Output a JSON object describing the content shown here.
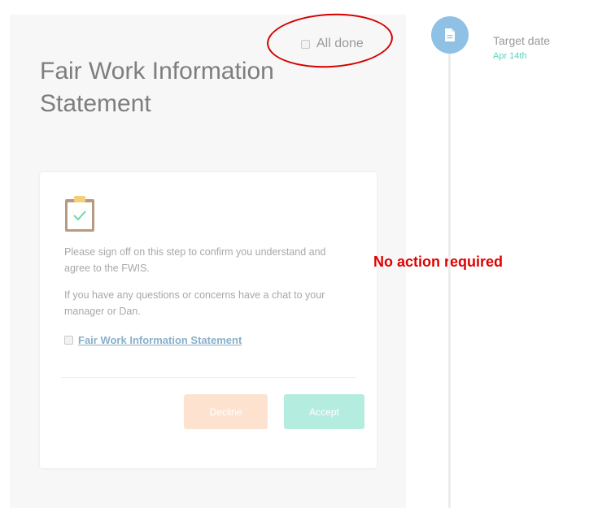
{
  "task": {
    "title": "Fair Work Information Statement",
    "all_done_label": "All done",
    "all_done_checked": false
  },
  "card": {
    "instruction_1": "Please sign off on this step to confirm you understand and agree to the FWIS.",
    "instruction_2": "If you have any questions or concerns have a chat to your manager or Dan.",
    "document_link": "Fair Work Information Statement",
    "document_checked": false,
    "decline_label": "Decline",
    "accept_label": "Accept"
  },
  "annotation": {
    "note": "No action required",
    "color": "#e00000"
  },
  "timeline": {
    "icon": "document-icon",
    "target_label": "Target date",
    "target_date": "Apr 14th"
  },
  "colors": {
    "accent_teal": "#5cd4bd",
    "accept_bg": "#b5ece0",
    "decline_bg": "#fde3cf",
    "timeline_dot": "#8fc1e5",
    "link": "#8ab0c8"
  }
}
